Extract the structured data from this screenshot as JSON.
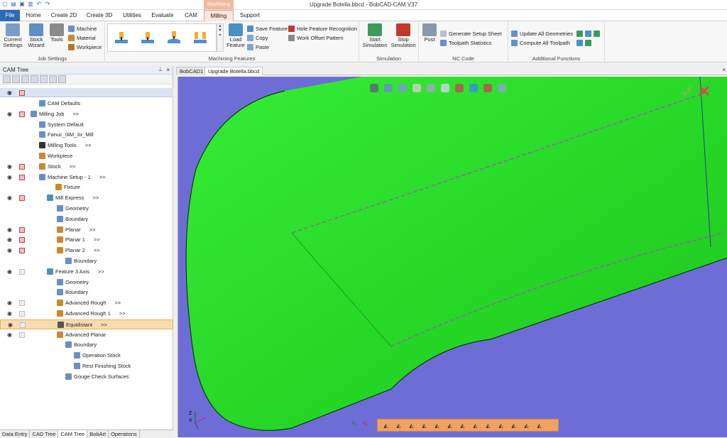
{
  "window": {
    "title": "Upgrade Botella.bbcd - BobCAD-CAM V37",
    "context_group": "Machining"
  },
  "quick_access": [
    "new-icon",
    "open-icon",
    "save-icon",
    "print-icon",
    "undo-icon",
    "redo-icon"
  ],
  "tabs": [
    {
      "label": "File",
      "file": true
    },
    {
      "label": "Home"
    },
    {
      "label": "Create 2D"
    },
    {
      "label": "Create 3D"
    },
    {
      "label": "Utilities"
    },
    {
      "label": "Evaluate"
    },
    {
      "label": "CAM"
    },
    {
      "label": "Milling",
      "active": true
    },
    {
      "label": "Support"
    }
  ],
  "ribbon": {
    "job_settings": {
      "label": "Job Settings",
      "current_settings": "Current Settings",
      "stock_wizard": "Stock Wizard",
      "tools": "Tools",
      "machine": "Machine",
      "material": "Material",
      "workpiece": "Workpiece"
    },
    "machining_features": {
      "label": "Machining Features",
      "load_feature": "Load Feature",
      "save_feature": "Save Feature",
      "copy": "Copy",
      "paste": "Paste",
      "hole_feature_recognition": "Hole Feature Recognition",
      "work_offset_pattern": "Work Offset Pattern"
    },
    "simulation": {
      "label": "Simulation",
      "start": "Start Simulation",
      "stop": "Stop Simulation"
    },
    "nc_code": {
      "label": "NC Code",
      "post": "Post",
      "generate_setup_sheet": "Generate Setup Sheet",
      "toolpath_statistics": "Toolpath Statistics"
    },
    "additional": {
      "label": "Additional Functions",
      "update_all": "Update All Geometries",
      "compute_all": "Compute All Toolpath"
    }
  },
  "cam_tree": {
    "title": "CAM Tree",
    "rows": [
      {
        "label": "CAM Defaults",
        "indent": 55,
        "icon": "#6a8fc4"
      },
      {
        "label": "Milling Job",
        "suffix": ">>",
        "indent": 43,
        "icon": "#6a8fc4",
        "eye": true,
        "flag": true
      },
      {
        "label": "System Default",
        "indent": 55,
        "icon": "#6a8fc4"
      },
      {
        "label": "Fanuc_0iM_3x_Mill",
        "indent": 55,
        "icon": "#6a8fc4"
      },
      {
        "label": "Milling Tools",
        "suffix": ">>",
        "indent": 55,
        "icon": "#333"
      },
      {
        "label": "Workpiece",
        "indent": 55,
        "icon": "#c98a2d"
      },
      {
        "label": "Stock",
        "suffix": ">>",
        "indent": 55,
        "icon": "#c98a2d",
        "eye": true,
        "flag": true
      },
      {
        "label": "Machine Setup - 1",
        "suffix": ">>",
        "indent": 55,
        "icon": "#6a8fc4",
        "eye": true,
        "flag": true
      },
      {
        "label": "Fixture",
        "indent": 78,
        "icon": "#c98a2d"
      },
      {
        "label": "Mill Express",
        "suffix": ">>",
        "indent": 66,
        "icon": "#4a90c4",
        "eye": true,
        "flag": true
      },
      {
        "label": "Geometry",
        "indent": 80,
        "icon": "#6a8fc4"
      },
      {
        "label": "Boundary",
        "indent": 80,
        "icon": "#6a8fc4"
      },
      {
        "label": "Planar",
        "suffix": ">>",
        "indent": 80,
        "icon": "#c98a2d",
        "eye": true,
        "flag": true
      },
      {
        "label": "Planar 1",
        "suffix": ">>",
        "indent": 80,
        "icon": "#c98a2d",
        "eye": true,
        "flag": true
      },
      {
        "label": "Planar 2",
        "suffix": ">>",
        "indent": 80,
        "icon": "#c98a2d",
        "eye": true,
        "flag": true
      },
      {
        "label": "Boundary",
        "indent": 92,
        "icon": "#6a8fc4"
      },
      {
        "label": "Feature 3 Axis",
        "suffix": ">>",
        "indent": 66,
        "icon": "#4a90c4",
        "eye": true,
        "flag_grey": true
      },
      {
        "label": "Geometry",
        "indent": 80,
        "icon": "#6a8fc4"
      },
      {
        "label": "Boundary",
        "indent": 80,
        "icon": "#6a8fc4"
      },
      {
        "label": "Advanced Rough",
        "suffix": ">>",
        "indent": 80,
        "icon": "#c98a2d",
        "eye": true,
        "flag_grey": true
      },
      {
        "label": "Advanced Rough 1",
        "suffix": ">>",
        "indent": 80,
        "icon": "#c98a2d",
        "eye": true,
        "flag_grey": true
      },
      {
        "label": "Equidistant",
        "suffix": ">>",
        "indent": 80,
        "icon": "#555",
        "eye": true,
        "flag_grey": true,
        "selected": true
      },
      {
        "label": "Advanced Planar",
        "indent": 80,
        "icon": "#c98a2d",
        "eye": true,
        "flag_grey": true
      },
      {
        "label": "Boundary",
        "indent": 92,
        "icon": "#6a8fc4"
      },
      {
        "label": "Operation Stock",
        "indent": 104,
        "icon": "#6a8fc4"
      },
      {
        "label": "Rest Finishing Stock",
        "indent": 104,
        "icon": "#6a8fc4"
      },
      {
        "label": "Gouge Check Surfaces",
        "indent": 92,
        "icon": "#6a8fc4"
      }
    ]
  },
  "bottom_tabs": [
    {
      "label": "Data Entry"
    },
    {
      "label": "CAD Tree"
    },
    {
      "label": "CAM Tree",
      "active": true
    },
    {
      "label": "BobArt"
    },
    {
      "label": "Operations"
    }
  ],
  "doc_tabs": [
    {
      "label": "BobCAD1"
    },
    {
      "label": "Upgrade Botella.bbcd",
      "active": true
    }
  ],
  "viewport": {
    "background": "#6e6dd6",
    "toolpath_color": "#2de82d",
    "axis_labels": [
      "Z",
      "X"
    ]
  },
  "colors": {
    "accent": "#2f6ab7",
    "context_tab": "#f3b9a0",
    "selected_row": "#f9dcad",
    "bottom_toolbar": "#f0a35e"
  }
}
